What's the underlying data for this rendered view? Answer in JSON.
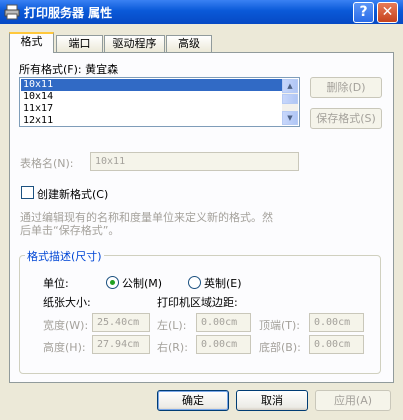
{
  "window": {
    "title": "打印服务器 属性",
    "help_label": "?",
    "close_label": "✕"
  },
  "tabs": [
    "格式",
    "端口",
    "驱动程序",
    "高级"
  ],
  "formats": {
    "label": "所有格式(F): 黄宜森",
    "items": [
      "10x11",
      "10x14",
      "11x17",
      "12x11"
    ],
    "selected": "10x11"
  },
  "side_buttons": {
    "delete_label": "删除(D)",
    "save_label": "保存格式(S)"
  },
  "form_name": {
    "label": "表格名(N):",
    "value": "10x11"
  },
  "create_new": {
    "label": "创建新格式(C)",
    "checked": false
  },
  "description": [
    "通过编辑现有的名称和度量单位来定义新的格式。然",
    "后单击“保存格式”。"
  ],
  "format_desc": {
    "title": "格式描述(尺寸)",
    "unit_label": "单位:",
    "metric_label": "公制(M)",
    "imperial_label": "英制(E)",
    "metric_selected": true,
    "paper_size_label": "纸张大小:",
    "printer_area_label": "打印机区域边距:",
    "width_label": "宽度(W):",
    "width_value": "25.40cm",
    "height_label": "高度(H):",
    "height_value": "27.94cm",
    "left_label": "左(L):",
    "left_value": "0.00cm",
    "right_label": "右(R):",
    "right_value": "0.00cm",
    "top_label": "顶端(T):",
    "top_value": "0.00cm",
    "bottom_label": "底部(B):",
    "bottom_value": "0.00cm"
  },
  "footer": {
    "ok_label": "确定",
    "cancel_label": "取消",
    "apply_label": "应用(A)"
  }
}
